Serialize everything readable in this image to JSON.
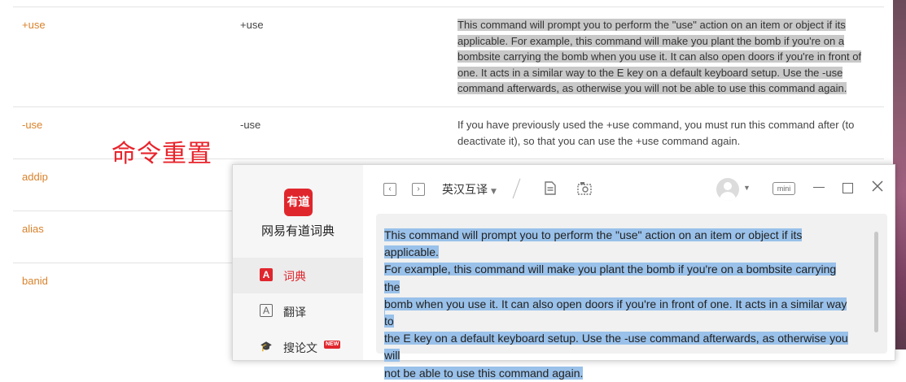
{
  "commands": [
    {
      "name": "+use",
      "syntax": "+use",
      "description_lines": [
        "This command will prompt you to perform the \"use\" action on an item or object if its",
        "applicable. For example, this command will make you plant the bomb if you're on a",
        "bombsite carrying the bomb when you use it. It can also open doors if you're in front of",
        "one. It acts in a similar way to the E key on a default keyboard setup. Use the -use",
        "command afterwards, as otherwise you will not be able to use this command again."
      ]
    },
    {
      "name": "-use",
      "syntax": "-use",
      "description_lines": [
        "If you have previously used the +use command, you must run this command after (to",
        "deactivate it), so that you can use the +use command again."
      ]
    },
    {
      "name": "addip",
      "syntax": "",
      "description_lines": []
    },
    {
      "name": "alias",
      "syntax": "",
      "description_lines": []
    },
    {
      "name": "banid",
      "syntax": "",
      "description_lines": []
    }
  ],
  "annotation": "命令重置",
  "youdao": {
    "logo_text": "有道",
    "app_name": "网易有道词典",
    "nav": [
      {
        "label": "词典",
        "icon": "A",
        "icon_name": "dictionary-icon",
        "active": true
      },
      {
        "label": "翻译",
        "icon": "A",
        "icon_name": "translate-icon",
        "active": false
      },
      {
        "label": "搜论文",
        "icon": "🎓",
        "icon_name": "paper-search-icon",
        "badge": "NEW",
        "active": false
      }
    ],
    "toolbar": {
      "back": "‹",
      "forward": "›",
      "language": "英汉互译",
      "mini_label": "mini"
    },
    "input_lines": [
      "This command will prompt you to perform the \"use\" action on an item or object if its applicable.",
      "For example, this command will make you plant the bomb if you're on a bombsite carrying the",
      "bomb when you use it.  It can also open doors if you're in front of one.  It acts in a similar way to",
      "the E key on a default keyboard setup.  Use the -use command afterwards, as otherwise you will",
      "not be able to use this command again."
    ],
    "accent_color": "#e0262d",
    "selection_color": "#99c1ea"
  }
}
